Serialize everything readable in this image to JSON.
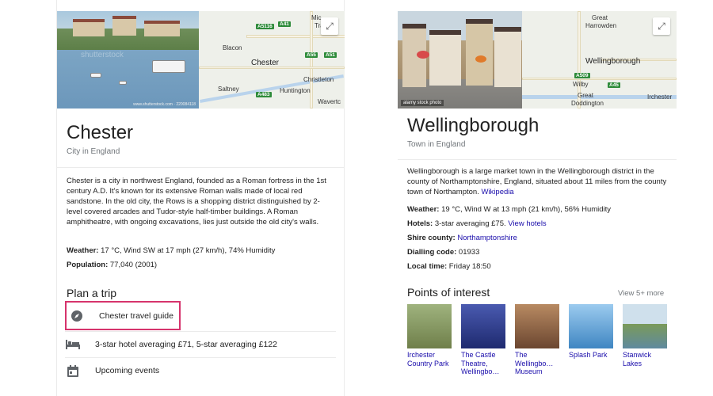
{
  "chester": {
    "title": "Chester",
    "subtitle": "City in England",
    "photo_caption": "www.shutterstock.com · 220084118",
    "watermark": "shutterstock",
    "map": {
      "places": [
        "Mic",
        "Traf",
        "Blacon",
        "Chester",
        "Saltney",
        "Christleton",
        "Huntington",
        "Wavertc"
      ],
      "shields": [
        "A5116",
        "A41",
        "A55",
        "A51",
        "A483"
      ]
    },
    "description": "Chester is a city in northwest England, founded as a Roman fortress in the 1st century A.D. It's known for its extensive Roman walls made of local red sandstone. In the old city, the Rows is a shopping district distinguished by 2-level covered arcades and Tudor-style half-timber buildings. A Roman amphitheatre, with ongoing excavations, lies just outside the old city's walls.",
    "weather_label": "Weather:",
    "weather_value": " 17 °C, Wind SW at 17 mph (27 km/h), 74% Humidity",
    "population_label": "Population:",
    "population_value": " 77,040 (2001)",
    "plan_heading": "Plan a trip",
    "trip": [
      {
        "icon": "compass-icon",
        "label": "Chester travel guide"
      },
      {
        "icon": "hotel-bed-icon",
        "label": "3-star hotel averaging £71, 5-star averaging £122"
      },
      {
        "icon": "calendar-icon",
        "label": "Upcoming events"
      }
    ]
  },
  "wellingborough": {
    "title": "Wellingborough",
    "subtitle": "Town in England",
    "photo_caption": "alamy stock photo",
    "map": {
      "places": [
        "Great",
        "Harrowden",
        "Wellingborough",
        "Wilby",
        "Great",
        "Doddington",
        "Irchester"
      ],
      "shields": [
        "A509",
        "A45"
      ]
    },
    "description": "Wellingborough is a large market town in the Wellingborough district in the county of Northamptonshire, England, situated about 11 miles from the county town of Northampton.",
    "description_link": "Wikipedia",
    "weather_label": "Weather:",
    "weather_value": " 19 °C, Wind W at 13 mph (21 km/h), 56% Humidity",
    "hotels_label": "Hotels:",
    "hotels_value": " 3-star averaging £75.",
    "hotels_link": "View hotels",
    "shire_label": "Shire county:",
    "shire_link": "Northamptonshire",
    "dialling_label": "Dialling code:",
    "dialling_value": " 01933",
    "localtime_label": "Local time:",
    "localtime_value": " Friday 18:50",
    "poi_heading": "Points of interest",
    "poi_viewmore": "View 5+ more",
    "poi": [
      {
        "label": "Irchester Country Park",
        "color": "#6f7f4a"
      },
      {
        "label": "The Castle Theatre, Wellingbo…",
        "color": "#2e3f8f"
      },
      {
        "label": "The Wellingbo… Museum",
        "color": "#8a5a3c"
      },
      {
        "label": "Splash Park",
        "color": "#5aa0d8"
      },
      {
        "label": "Stanwick Lakes",
        "color": "#7fa6c2"
      }
    ]
  }
}
